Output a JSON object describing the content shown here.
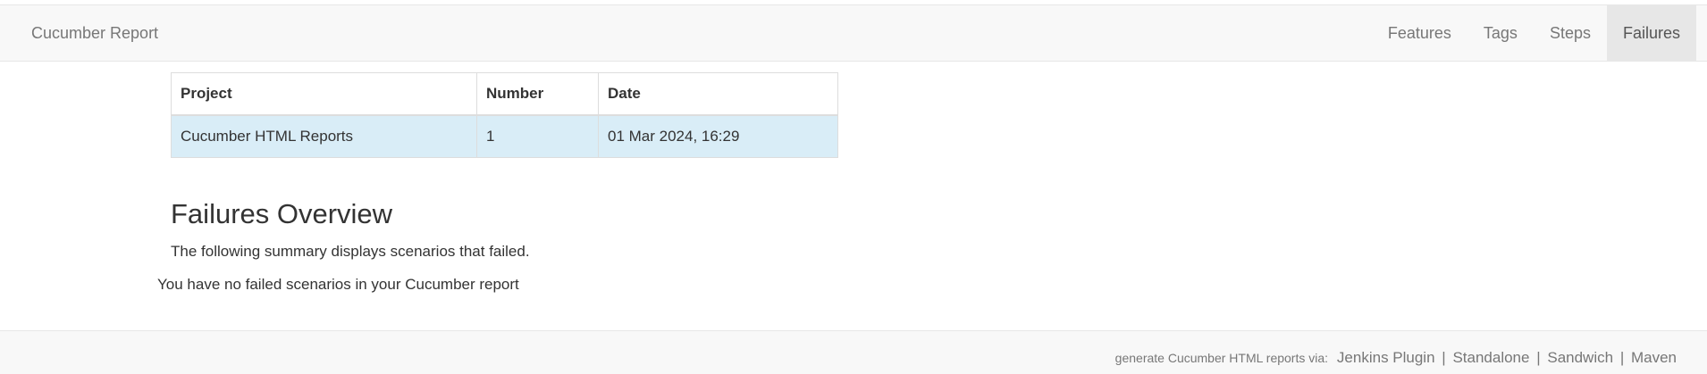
{
  "navbar": {
    "brand": "Cucumber Report",
    "items": [
      {
        "label": "Features",
        "active": false
      },
      {
        "label": "Tags",
        "active": false
      },
      {
        "label": "Steps",
        "active": false
      },
      {
        "label": "Failures",
        "active": true
      }
    ]
  },
  "build_table": {
    "headers": [
      "Project",
      "Number",
      "Date"
    ],
    "rows": [
      [
        "Cucumber HTML Reports",
        "1",
        "01 Mar 2024, 16:29"
      ]
    ]
  },
  "main": {
    "title": "Failures Overview",
    "summary": "The following summary displays scenarios that failed.",
    "empty_message": "You have no failed scenarios in your Cucumber report"
  },
  "footer": {
    "prefix": "generate Cucumber HTML reports via:",
    "links": [
      "Jenkins Plugin",
      "Standalone",
      "Sandwich",
      "Maven"
    ],
    "separator": "|"
  },
  "colors": {
    "navbar_bg": "#f8f8f8",
    "active_tab_bg": "#e7e7e7",
    "row_highlight": "#d9edf7"
  }
}
